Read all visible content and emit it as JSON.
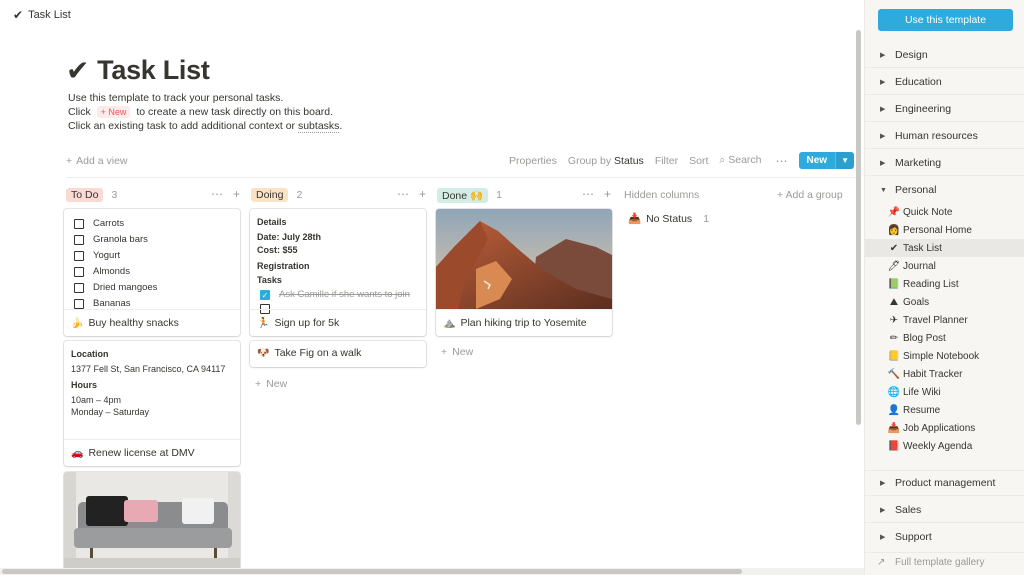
{
  "topbar": {
    "icon": "checkmark-icon",
    "title": "Task List"
  },
  "page": {
    "title": "Task List",
    "desc1": "Use this template to track your personal tasks.",
    "desc2_pre": "Click",
    "new_chip": "+ New",
    "desc2_post": "to create a new task directly on this board.",
    "desc3_pre": "Click an existing task to add additional context or",
    "desc3_link": "subtasks",
    "desc3_post": "."
  },
  "toolbar": {
    "add_view": "Add a view",
    "properties": "Properties",
    "group_by": "Group by",
    "group_by_value": "Status",
    "filter": "Filter",
    "sort": "Sort",
    "search": "Search",
    "new": "New"
  },
  "board": {
    "columns": [
      {
        "label": "To Do",
        "count": "3",
        "color": "#fbd9d4"
      },
      {
        "label": "Doing",
        "count": "2",
        "color": "#fae3c5"
      },
      {
        "label": "Done 🙌",
        "count": "1",
        "color": "#d3ede6"
      }
    ],
    "hidden_columns": "Hidden columns",
    "add_group": "Add a group",
    "no_status": "No Status",
    "no_status_count": "1",
    "new_label": "New"
  },
  "cards": {
    "snacks": {
      "items": [
        "Carrots",
        "Granola bars",
        "Yogurt",
        "Almonds",
        "Dried mangoes",
        "Bananas"
      ],
      "emoji": "🍌",
      "title": "Buy healthy snacks"
    },
    "dmv": {
      "location_label": "Location",
      "location": "1377 Fell St, San Francisco, CA 94117",
      "hours_label": "Hours",
      "hours1": "10am – 4pm",
      "hours2": "Monday – Saturday",
      "emoji": "🚗",
      "title": "Renew license at DMV"
    },
    "fivek": {
      "details_label": "Details",
      "date": "Date: July 28th",
      "cost": "Cost: $55",
      "registration": "Registration",
      "tasks_label": "Tasks",
      "task1": "Ask Camille if she wants to join",
      "emoji": "🏃",
      "title": "Sign up for 5k"
    },
    "fig": {
      "emoji": "🐶",
      "title": "Take Fig on a walk"
    },
    "hiking": {
      "emoji": "⛰️",
      "title": "Plan hiking trip to Yosemite"
    }
  },
  "sidebar": {
    "use_template": "Use this template",
    "categories_top": [
      "Design",
      "Education",
      "Engineering",
      "Human resources",
      "Marketing"
    ],
    "personal": "Personal",
    "templates": [
      {
        "icon": "📌",
        "label": "Quick Note"
      },
      {
        "icon": "👩",
        "label": "Personal Home"
      },
      {
        "icon": "✔",
        "label": "Task List"
      },
      {
        "icon": "🖊",
        "label": "Journal"
      },
      {
        "icon": "📗",
        "label": "Reading List"
      },
      {
        "icon": "⛰",
        "label": "Goals"
      },
      {
        "icon": "✈",
        "label": "Travel Planner"
      },
      {
        "icon": "✏",
        "label": "Blog Post"
      },
      {
        "icon": "📒",
        "label": "Simple Notebook"
      },
      {
        "icon": "🔨",
        "label": "Habit Tracker"
      },
      {
        "icon": "🌐",
        "label": "Life Wiki"
      },
      {
        "icon": "👤",
        "label": "Resume"
      },
      {
        "icon": "📥",
        "label": "Job Applications"
      },
      {
        "icon": "📕",
        "label": "Weekly Agenda"
      }
    ],
    "categories_bottom": [
      "Product management",
      "Sales",
      "Support"
    ],
    "gallery": "Full template gallery"
  }
}
